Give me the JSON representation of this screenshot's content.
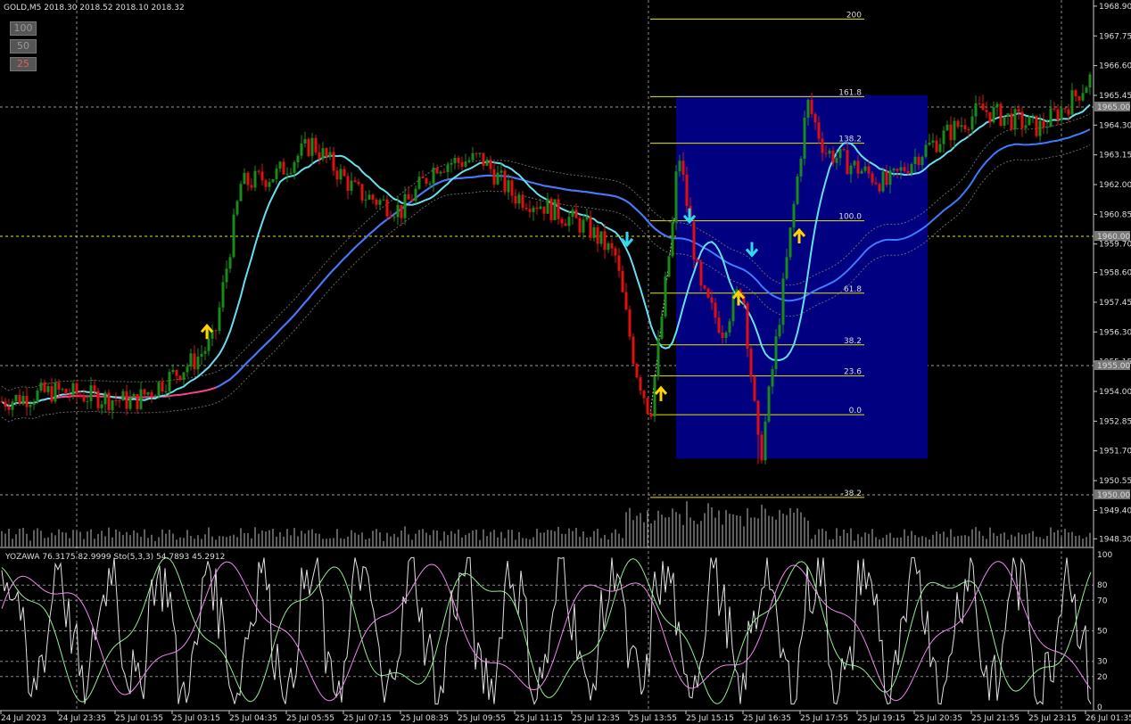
{
  "window": {
    "title": "GOLD,M5  2018.30 2018.52 2018.10 2018.32"
  },
  "zoom_buttons": [
    {
      "label": "100",
      "color": "#9a9a9a"
    },
    {
      "label": "50",
      "color": "#9a9a9a"
    },
    {
      "label": "25",
      "color": "#e06060"
    }
  ],
  "indicator": {
    "label": "YOZAWA 76.3175 82.9999  Sto(5,3,3) 54.7893 45.2912"
  },
  "colors": {
    "bull": "#1a8a1a",
    "bear": "#e01010",
    "ma_fast": "#66e0f0",
    "ma_slow": "#3d7bff",
    "ma_red": "#ff4090",
    "fib": "#e8e800",
    "box": "#000080",
    "arrow_up": "#ffd400",
    "arrow_down": "#30d8f0"
  },
  "chart_data": {
    "type": "candlestick",
    "instrument": "GOLD",
    "timeframe": "M5",
    "ylim": [
      1948.0,
      1969.0
    ],
    "price_ticks": [
      "1968.90",
      "1967.75",
      "1966.60",
      "1965.45",
      "1964.30",
      "1963.15",
      "1962.00",
      "1960.85",
      "1959.70",
      "1958.60",
      "1957.45",
      "1956.30",
      "1955.15",
      "1954.00",
      "1952.85",
      "1951.70",
      "1950.55",
      "1949.40",
      "1948.30"
    ],
    "price_markers": [
      "1965.00",
      "1960.00",
      "1955.00",
      "1950.00"
    ],
    "time_labels": [
      "24 Jul 2023",
      "24 Jul 23:35",
      "25 Jul 01:55",
      "25 Jul 03:15",
      "25 Jul 04:35",
      "25 Jul 05:55",
      "25 Jul 07:15",
      "25 Jul 08:35",
      "25 Jul 09:55",
      "25 Jul 11:15",
      "25 Jul 12:35",
      "25 Jul 13:55",
      "25 Jul 15:15",
      "25 Jul 16:35",
      "25 Jul 17:55",
      "25 Jul 19:15",
      "25 Jul 20:35",
      "25 Jul 21:55",
      "25 Jul 23:15",
      "26 Jul 01:35"
    ],
    "key_prices": [
      1953.6,
      1954.0,
      1953.6,
      1955.2,
      1956.0,
      1962.0,
      1962.4,
      1963.6,
      1961.7,
      1961.0,
      1962.8,
      1963.0,
      1961.6,
      1961.2,
      1960.3,
      1959.2,
      1955.0,
      1953.1,
      1961.0,
      1963.5,
      1957.9,
      1956.4,
      1958.2,
      1951.2,
      1958.5,
      1965.2,
      1963.3,
      1962.0,
      1963.2,
      1964.9,
      1964.2,
      1965.2,
      1966.1
    ],
    "fib_levels": [
      {
        "label": "200",
        "price": 1968.4
      },
      {
        "label": "161.8",
        "price": 1965.4
      },
      {
        "label": "138.2",
        "price": 1963.6
      },
      {
        "label": "100.0",
        "price": 1960.6
      },
      {
        "label": "61.8",
        "price": 1957.8
      },
      {
        "label": "38.2",
        "price": 1955.8
      },
      {
        "label": "23.6",
        "price": 1954.6
      },
      {
        "label": "0.0",
        "price": 1953.1
      },
      {
        "label": "-38.2",
        "price": 1949.9
      }
    ],
    "osc_levels": [
      "100",
      "80",
      "70",
      "50",
      "30",
      "20",
      "0"
    ]
  }
}
